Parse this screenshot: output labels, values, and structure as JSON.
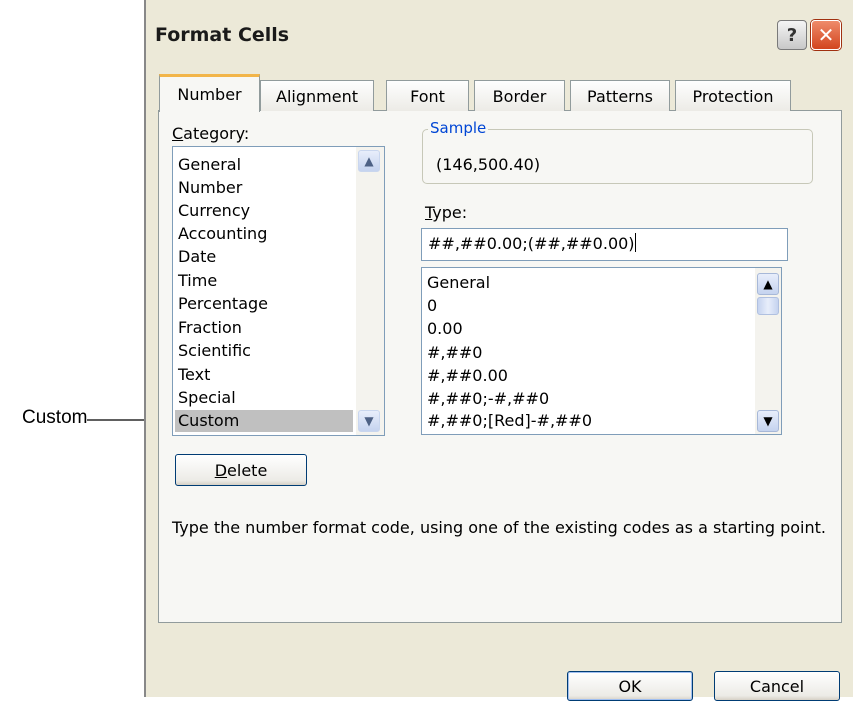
{
  "annotation": {
    "label": "Custom"
  },
  "window": {
    "title": "Format Cells",
    "help_icon": "?",
    "close_icon": "✕"
  },
  "tabs": [
    {
      "label": "Number",
      "active": true
    },
    {
      "label": "Alignment"
    },
    {
      "label": "Font"
    },
    {
      "label": "Border"
    },
    {
      "label": "Patterns"
    },
    {
      "label": "Protection"
    }
  ],
  "category": {
    "label_accel": "C",
    "label_rest": "ategory:",
    "items": [
      "General",
      "Number",
      "Currency",
      "Accounting",
      "Date",
      "Time",
      "Percentage",
      "Fraction",
      "Scientific",
      "Text",
      "Special",
      "Custom"
    ],
    "selected": "Custom"
  },
  "sample": {
    "legend": "Sample",
    "value": "(146,500.40)"
  },
  "type": {
    "label_accel": "T",
    "label_rest": "ype:",
    "value": "##,##0.00;(##,##0.00)",
    "items": [
      "General",
      "0",
      "0.00",
      "#,##0",
      "#,##0.00",
      "#,##0;-#,##0",
      "#,##0;[Red]-#,##0"
    ]
  },
  "delete_button": {
    "accel": "D",
    "rest": "elete"
  },
  "help_text": "Type the number format code, using one of the existing codes as a starting point.",
  "ok_label": "OK",
  "cancel_label": "Cancel",
  "colors": {
    "dialog_bg": "#ece9d8",
    "panel_bg": "#f7f7f4",
    "active_tab_accent": "#f2b549",
    "sample_legend": "#0046d5",
    "selection": "#c0c0c0"
  }
}
